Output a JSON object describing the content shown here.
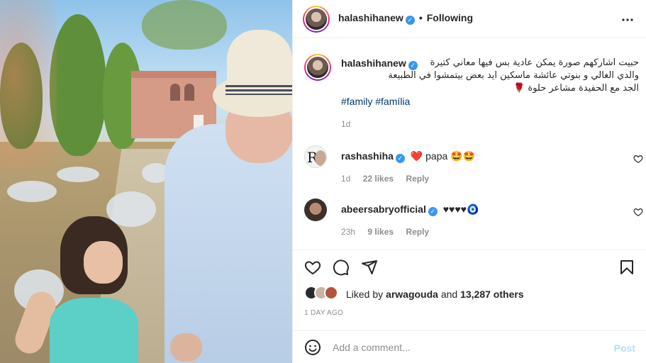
{
  "post": {
    "author": "halashihanew",
    "follow_status": "Following",
    "dot": "•",
    "more_icon": "more-horizontal-icon",
    "caption_lines": [
      "حبيت اشاركهم صورة يمكن عادية بس فيها معاني كتيرة",
      "والدي الغالي و بنوتي عائشة ماسكين ايد بعض بيتمشوا في الطبيعة",
      "الجد مع الحفيدة مشاعر حلوة 🌹"
    ],
    "hashtags": "#family #família",
    "age": "1d"
  },
  "comments": [
    {
      "username": "rashashiha",
      "text": "❤️ papa 🤩🤩",
      "age": "1d",
      "likes": "22 likes",
      "reply": "Reply"
    },
    {
      "username": "abeersabryofficial",
      "text": "♥♥♥♥🧿",
      "age": "23h",
      "likes": "9 likes",
      "reply": "Reply"
    }
  ],
  "likes": {
    "prefix": "Liked by",
    "user": "arwagouda",
    "middle": "and",
    "others": "13,287 others"
  },
  "date": "1 DAY AGO",
  "composer": {
    "placeholder": "Add a comment...",
    "post_label": "Post"
  },
  "colors": {
    "accent_blue": "#0095f6",
    "post_disabled": "#b2dffc",
    "hashtag": "#00376b",
    "secondary_text": "#8e8e8e"
  }
}
